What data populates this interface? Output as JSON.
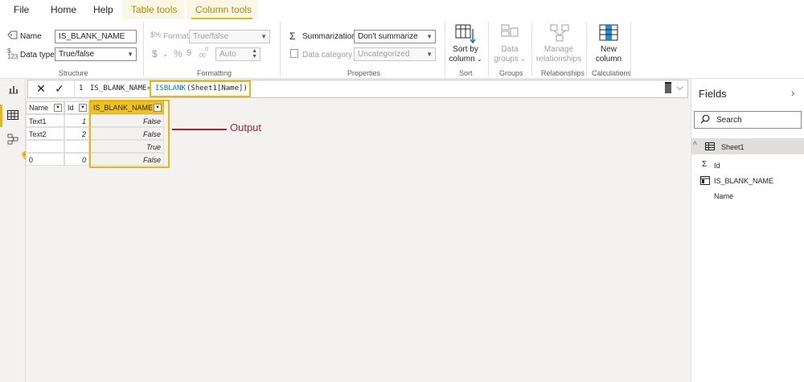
{
  "menubar": {
    "file": "File",
    "home": "Home",
    "help": "Help",
    "table_tools": "Table tools",
    "column_tools": "Column tools"
  },
  "ribbon": {
    "structure": {
      "name_label": "Name",
      "name_value": "IS_BLANK_NAME",
      "datatype_label": "Data type",
      "datatype_value": "True/false",
      "group_label": "Structure"
    },
    "formatting": {
      "format_label": "Format",
      "format_value": "True/false",
      "auto_value": "Auto",
      "group_label": "Formatting"
    },
    "properties": {
      "summarization_label": "Summarization",
      "summarization_value": "Don't summarize",
      "datacategory_label": "Data category",
      "datacategory_value": "Uncategorized",
      "group_label": "Properties"
    },
    "sort": {
      "line1": "Sort by",
      "line2": "column",
      "group_label": "Sort"
    },
    "groups": {
      "line1": "Data",
      "line2": "groups",
      "group_label": "Groups"
    },
    "relationships": {
      "line1": "Manage",
      "line2": "relationships",
      "group_label": "Relationships"
    },
    "calculations": {
      "line1": "New",
      "line2": "column",
      "group_label": "Calculations"
    }
  },
  "formula_bar": {
    "line_number": "1",
    "column_name": "IS_BLANK_NAME",
    "equals": "=",
    "function": "ISBLANK",
    "argument": "(Sheet1[Name])"
  },
  "table": {
    "headers": [
      "Name",
      "Id",
      "IS_BLANK_NAME"
    ],
    "rows": [
      [
        "Text1",
        "1",
        "False"
      ],
      [
        "Text2",
        "2",
        "False"
      ],
      [
        "",
        "",
        "True"
      ],
      [
        "0",
        "0",
        "False"
      ]
    ]
  },
  "annotation": {
    "label": "Output",
    "color": "#a4262c"
  },
  "fields_pane": {
    "title": "Fields",
    "search_placeholder": "Search",
    "table_name": "Sheet1",
    "fields": [
      "Id",
      "IS_BLANK_NAME",
      "Name"
    ]
  },
  "colors": {
    "accent": "#e8b80a",
    "context_tab": "#b88a00"
  }
}
